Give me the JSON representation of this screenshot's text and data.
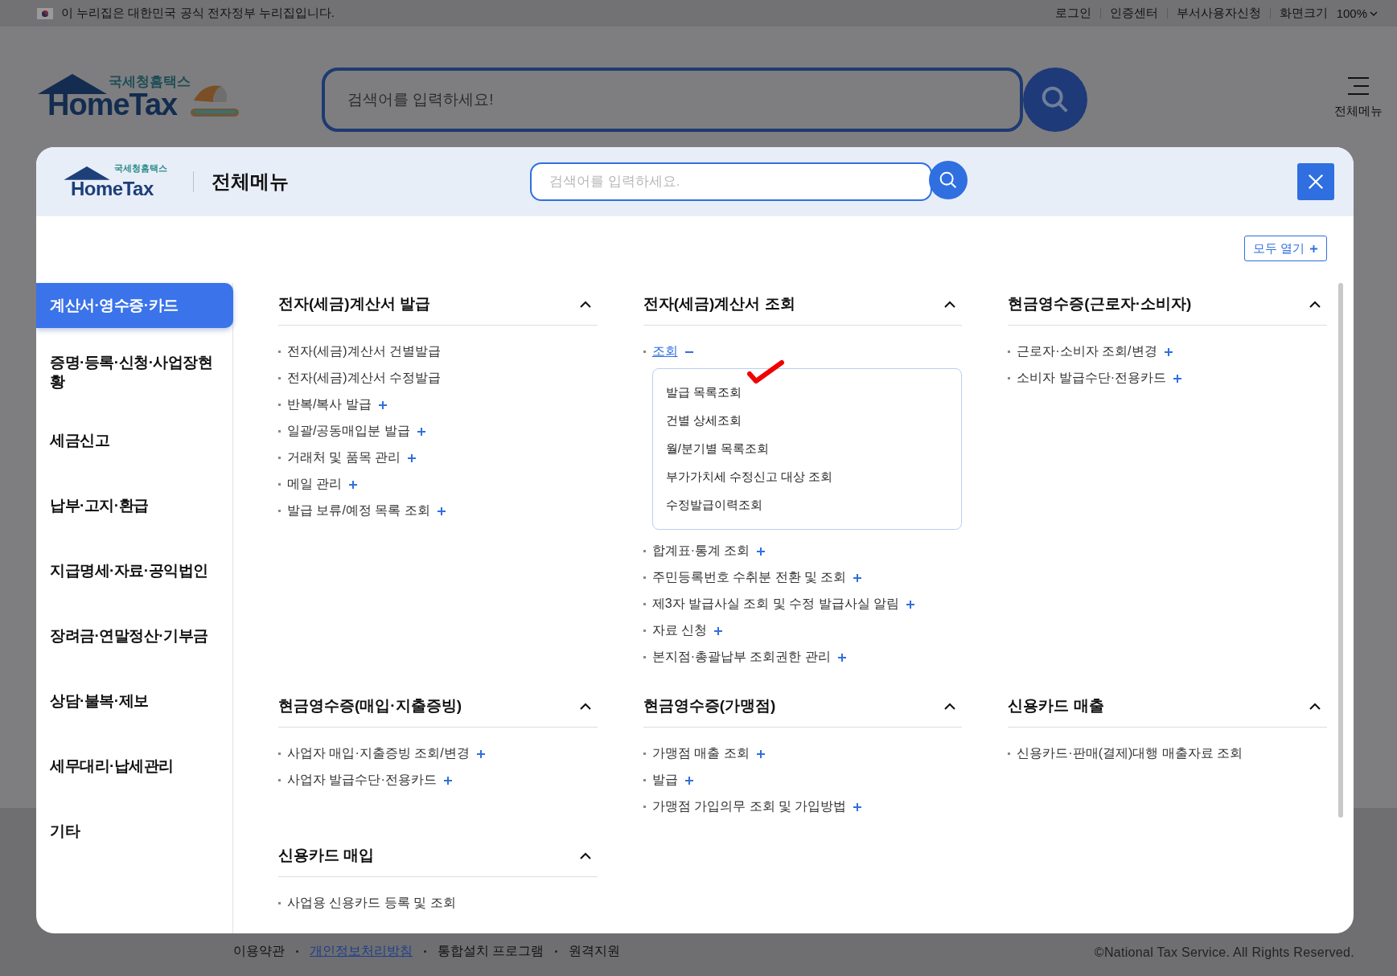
{
  "gov_banner": {
    "text": "이 누리집은 대한민국 공식 전자정부 누리집입니다."
  },
  "utility_links": [
    "로그인",
    "인증센터",
    "부서사용자신청"
  ],
  "font_size": {
    "label": "화면크기",
    "value": "100%"
  },
  "header": {
    "logo_sub": "국세청홈택스",
    "logo_brand": "HomeTax",
    "search": {
      "placeholder": "검색어를 입력하세요!"
    },
    "menu_label": "전체메뉴"
  },
  "modal": {
    "logo_sub": "국세청홈택스",
    "logo_brand": "HomeTax",
    "title": "전체메뉴",
    "search": {
      "placeholder": "검색어를 입력하세요."
    },
    "expand_all": "모두 열기",
    "sidebar": [
      {
        "label": "계산서·영수증·카드",
        "selected": true
      },
      {
        "label": "증명·등록·신청·사업장현황",
        "selected": false
      },
      {
        "label": "세금신고",
        "selected": false
      },
      {
        "label": "납부·고지·환급",
        "selected": false
      },
      {
        "label": "지급명세·자료·공익법인",
        "selected": false
      },
      {
        "label": "장려금·연말정산·기부금",
        "selected": false
      },
      {
        "label": "상담·불복·제보",
        "selected": false
      },
      {
        "label": "세무대리·납세관리",
        "selected": false
      },
      {
        "label": "기타",
        "selected": false
      }
    ],
    "sections": [
      {
        "title": "전자(세금)계산서 발급",
        "expanded": true,
        "items": [
          {
            "label": "전자(세금)계산서 건별발급",
            "kind": "link"
          },
          {
            "label": "전자(세금)계산서 수정발급",
            "kind": "link"
          },
          {
            "label": "반복/복사 발급",
            "kind": "group",
            "expanded": false
          },
          {
            "label": "일괄/공동매입분 발급",
            "kind": "group",
            "expanded": false
          },
          {
            "label": "거래처 및 품목 관리",
            "kind": "group",
            "expanded": false
          },
          {
            "label": "메일 관리",
            "kind": "group",
            "expanded": false
          },
          {
            "label": "발급 보류/예정 목록 조회",
            "kind": "group",
            "expanded": false
          }
        ]
      },
      {
        "title": "전자(세금)계산서 조회",
        "expanded": true,
        "items": [
          {
            "label": "조회",
            "kind": "group",
            "expanded": true,
            "children": [
              {
                "label": "발급 목록조회",
                "marked": true
              },
              {
                "label": "건별 상세조회",
                "marked": false
              },
              {
                "label": "월/분기별 목록조회",
                "marked": false
              },
              {
                "label": "부가가치세 수정신고 대상 조회",
                "marked": false
              },
              {
                "label": "수정발급이력조회",
                "marked": false
              }
            ]
          },
          {
            "label": "합계표·통계 조회",
            "kind": "group",
            "expanded": false
          },
          {
            "label": "주민등록번호 수취분 전환 및 조회",
            "kind": "group",
            "expanded": false
          },
          {
            "label": "제3자 발급사실 조회 및 수정 발급사실 알림",
            "kind": "group",
            "expanded": false
          },
          {
            "label": "자료 신청",
            "kind": "group",
            "expanded": false
          },
          {
            "label": "본지점·총괄납부 조회권한 관리",
            "kind": "group",
            "expanded": false
          }
        ]
      },
      {
        "title": "현금영수증(근로자·소비자)",
        "expanded": true,
        "items": [
          {
            "label": "근로자·소비자 조회/변경",
            "kind": "group",
            "expanded": false
          },
          {
            "label": "소비자 발급수단·전용카드",
            "kind": "group",
            "expanded": false
          }
        ]
      },
      {
        "title": "현금영수증(매입·지출증빙)",
        "expanded": true,
        "items": [
          {
            "label": "사업자 매입·지출증빙 조회/변경",
            "kind": "group",
            "expanded": false
          },
          {
            "label": "사업자 발급수단·전용카드",
            "kind": "group",
            "expanded": false
          }
        ]
      },
      {
        "title": "현금영수증(가맹점)",
        "expanded": true,
        "items": [
          {
            "label": "가맹점 매출 조회",
            "kind": "group",
            "expanded": false
          },
          {
            "label": "발급",
            "kind": "group",
            "expanded": false
          },
          {
            "label": "가맹점 가입의무 조회 및 가입방법",
            "kind": "group",
            "expanded": false
          }
        ]
      },
      {
        "title": "신용카드 매출",
        "expanded": true,
        "items": [
          {
            "label": "신용카드·판매(결제)대행 매출자료 조회",
            "kind": "link"
          }
        ]
      },
      {
        "title": "신용카드 매입",
        "expanded": true,
        "items": [
          {
            "label": "사업용 신용카드 등록 및 조회",
            "kind": "link"
          }
        ]
      }
    ]
  },
  "footer": {
    "links": [
      {
        "label": "이용약관",
        "highlighted": false
      },
      {
        "label": "개인정보처리방침",
        "highlighted": true
      },
      {
        "label": "통합설치 프로그램",
        "highlighted": false
      },
      {
        "label": "원격지원",
        "highlighted": false
      }
    ],
    "copyright": "©National Tax Service. All Rights Reserved."
  }
}
